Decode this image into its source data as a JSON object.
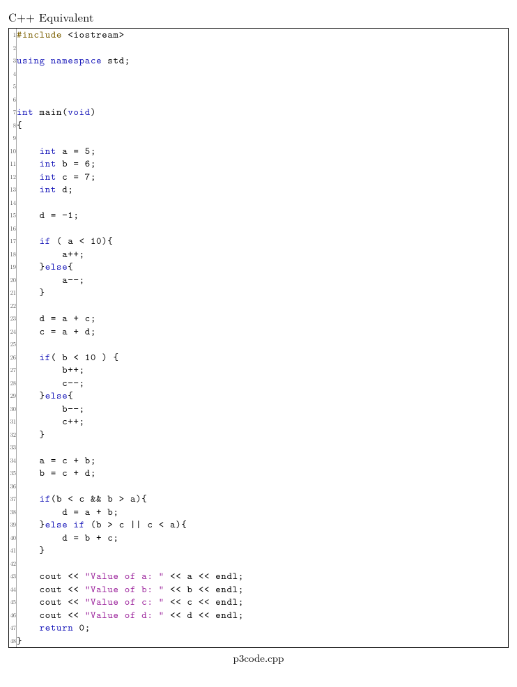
{
  "title": "C++ Equivalent",
  "filename": "p3code.cpp",
  "code_lines": [
    {
      "n": 1,
      "tokens": [
        {
          "t": "#include",
          "c": "pp"
        },
        {
          "t": " <iostream>",
          "c": ""
        }
      ]
    },
    {
      "n": 2,
      "tokens": []
    },
    {
      "n": 3,
      "tokens": [
        {
          "t": "using",
          "c": "kw"
        },
        {
          "t": " ",
          "c": ""
        },
        {
          "t": "namespace",
          "c": "kw"
        },
        {
          "t": " std;",
          "c": ""
        }
      ]
    },
    {
      "n": 4,
      "tokens": []
    },
    {
      "n": 5,
      "tokens": []
    },
    {
      "n": 6,
      "tokens": []
    },
    {
      "n": 7,
      "tokens": [
        {
          "t": "int",
          "c": "kw"
        },
        {
          "t": " main(",
          "c": ""
        },
        {
          "t": "void",
          "c": "kw"
        },
        {
          "t": ")",
          "c": ""
        }
      ]
    },
    {
      "n": 8,
      "tokens": [
        {
          "t": "{",
          "c": ""
        }
      ]
    },
    {
      "n": 9,
      "tokens": []
    },
    {
      "n": 10,
      "tokens": [
        {
          "t": "    ",
          "c": ""
        },
        {
          "t": "int",
          "c": "kw"
        },
        {
          "t": " a = 5;",
          "c": ""
        }
      ]
    },
    {
      "n": 11,
      "tokens": [
        {
          "t": "    ",
          "c": ""
        },
        {
          "t": "int",
          "c": "kw"
        },
        {
          "t": " b = 6;",
          "c": ""
        }
      ]
    },
    {
      "n": 12,
      "tokens": [
        {
          "t": "    ",
          "c": ""
        },
        {
          "t": "int",
          "c": "kw"
        },
        {
          "t": " c = 7;",
          "c": ""
        }
      ]
    },
    {
      "n": 13,
      "tokens": [
        {
          "t": "    ",
          "c": ""
        },
        {
          "t": "int",
          "c": "kw"
        },
        {
          "t": " d;",
          "c": ""
        }
      ]
    },
    {
      "n": 14,
      "tokens": []
    },
    {
      "n": 15,
      "tokens": [
        {
          "t": "    d = −1;",
          "c": ""
        }
      ]
    },
    {
      "n": 16,
      "tokens": []
    },
    {
      "n": 17,
      "tokens": [
        {
          "t": "    ",
          "c": ""
        },
        {
          "t": "if",
          "c": "kw"
        },
        {
          "t": " ( a < 10){",
          "c": ""
        }
      ]
    },
    {
      "n": 18,
      "tokens": [
        {
          "t": "        a++;",
          "c": ""
        }
      ]
    },
    {
      "n": 19,
      "tokens": [
        {
          "t": "    }",
          "c": ""
        },
        {
          "t": "else",
          "c": "kw"
        },
        {
          "t": "{",
          "c": ""
        }
      ]
    },
    {
      "n": 20,
      "tokens": [
        {
          "t": "        a−−;",
          "c": ""
        }
      ]
    },
    {
      "n": 21,
      "tokens": [
        {
          "t": "    }",
          "c": ""
        }
      ]
    },
    {
      "n": 22,
      "tokens": []
    },
    {
      "n": 23,
      "tokens": [
        {
          "t": "    d = a + c;",
          "c": ""
        }
      ]
    },
    {
      "n": 24,
      "tokens": [
        {
          "t": "    c = a + d;",
          "c": ""
        }
      ]
    },
    {
      "n": 25,
      "tokens": []
    },
    {
      "n": 26,
      "tokens": [
        {
          "t": "    ",
          "c": ""
        },
        {
          "t": "if",
          "c": "kw"
        },
        {
          "t": "( b < 10 ) {",
          "c": ""
        }
      ]
    },
    {
      "n": 27,
      "tokens": [
        {
          "t": "        b++;",
          "c": ""
        }
      ]
    },
    {
      "n": 28,
      "tokens": [
        {
          "t": "        c−−;",
          "c": ""
        }
      ]
    },
    {
      "n": 29,
      "tokens": [
        {
          "t": "    }",
          "c": ""
        },
        {
          "t": "else",
          "c": "kw"
        },
        {
          "t": "{",
          "c": ""
        }
      ]
    },
    {
      "n": 30,
      "tokens": [
        {
          "t": "        b−−;",
          "c": ""
        }
      ]
    },
    {
      "n": 31,
      "tokens": [
        {
          "t": "        c++;",
          "c": ""
        }
      ]
    },
    {
      "n": 32,
      "tokens": [
        {
          "t": "    }",
          "c": ""
        }
      ]
    },
    {
      "n": 33,
      "tokens": []
    },
    {
      "n": 34,
      "tokens": [
        {
          "t": "    a = c + b;",
          "c": ""
        }
      ]
    },
    {
      "n": 35,
      "tokens": [
        {
          "t": "    b = c + d;",
          "c": ""
        }
      ]
    },
    {
      "n": 36,
      "tokens": []
    },
    {
      "n": 37,
      "tokens": [
        {
          "t": "    ",
          "c": ""
        },
        {
          "t": "if",
          "c": "kw"
        },
        {
          "t": "(b < c && b > a){",
          "c": ""
        }
      ]
    },
    {
      "n": 38,
      "tokens": [
        {
          "t": "        d = a + b;",
          "c": ""
        }
      ]
    },
    {
      "n": 39,
      "tokens": [
        {
          "t": "    }",
          "c": ""
        },
        {
          "t": "else",
          "c": "kw"
        },
        {
          "t": " ",
          "c": ""
        },
        {
          "t": "if",
          "c": "kw"
        },
        {
          "t": " (b > c || c < a){",
          "c": ""
        }
      ]
    },
    {
      "n": 40,
      "tokens": [
        {
          "t": "        d = b + c;",
          "c": ""
        }
      ]
    },
    {
      "n": 41,
      "tokens": [
        {
          "t": "    }",
          "c": ""
        }
      ]
    },
    {
      "n": 42,
      "tokens": []
    },
    {
      "n": 43,
      "tokens": [
        {
          "t": "    cout << ",
          "c": ""
        },
        {
          "t": "\"Value of a: \"",
          "c": "str"
        },
        {
          "t": " << a << endl;",
          "c": ""
        }
      ]
    },
    {
      "n": 44,
      "tokens": [
        {
          "t": "    cout << ",
          "c": ""
        },
        {
          "t": "\"Value of b: \"",
          "c": "str"
        },
        {
          "t": " << b << endl;",
          "c": ""
        }
      ]
    },
    {
      "n": 45,
      "tokens": [
        {
          "t": "    cout << ",
          "c": ""
        },
        {
          "t": "\"Value of c: \"",
          "c": "str"
        },
        {
          "t": " << c << endl;",
          "c": ""
        }
      ]
    },
    {
      "n": 46,
      "tokens": [
        {
          "t": "    cout << ",
          "c": ""
        },
        {
          "t": "\"Value of d: \"",
          "c": "str"
        },
        {
          "t": " << d << endl;",
          "c": ""
        }
      ]
    },
    {
      "n": 47,
      "tokens": [
        {
          "t": "    ",
          "c": ""
        },
        {
          "t": "return",
          "c": "kw"
        },
        {
          "t": " 0;",
          "c": ""
        }
      ]
    },
    {
      "n": 48,
      "tokens": [
        {
          "t": "}",
          "c": ""
        }
      ]
    }
  ]
}
